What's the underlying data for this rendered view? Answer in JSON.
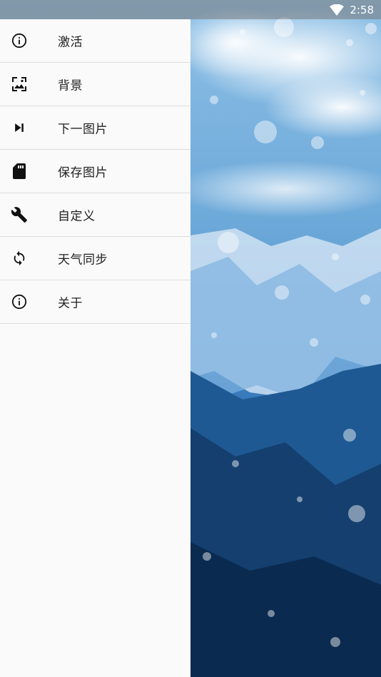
{
  "status_bar": {
    "time": "2:58",
    "wifi_icon": "wifi-icon"
  },
  "drawer": {
    "items": [
      {
        "label": "激活",
        "icon": "info-icon"
      },
      {
        "label": "背景",
        "icon": "wallpaper-icon"
      },
      {
        "label": "下一图片",
        "icon": "skip-next-icon"
      },
      {
        "label": "保存图片",
        "icon": "sd-card-icon"
      },
      {
        "label": "自定义",
        "icon": "wrench-icon"
      },
      {
        "label": "天气同步",
        "icon": "sync-icon"
      },
      {
        "label": "关于",
        "icon": "info-icon"
      }
    ]
  },
  "background": {
    "description_colors": [
      "#9ec7ea",
      "#5b98d1",
      "#1e5a94",
      "#0e3563"
    ]
  }
}
